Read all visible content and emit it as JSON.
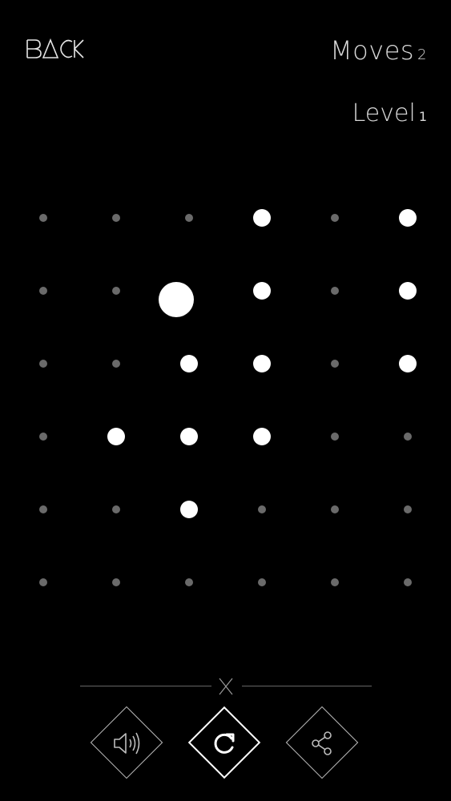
{
  "header": {
    "back_label": "BACK",
    "moves_label": "Moves",
    "moves_value": "2",
    "level_label": "Level",
    "level_value": "1"
  },
  "board": {
    "rows": 6,
    "cols": 6,
    "cells": [
      [
        "empty",
        "empty",
        "empty",
        "filled",
        "empty",
        "filled"
      ],
      [
        "empty",
        "empty",
        "big",
        "filled",
        "empty",
        "filled"
      ],
      [
        "empty",
        "empty",
        "filled",
        "filled",
        "empty",
        "filled"
      ],
      [
        "empty",
        "filled",
        "filled",
        "filled",
        "empty",
        "empty"
      ],
      [
        "empty",
        "empty",
        "filled",
        "empty",
        "empty",
        "empty"
      ],
      [
        "empty",
        "empty",
        "empty",
        "empty",
        "empty",
        "empty"
      ]
    ]
  },
  "controls": {
    "buttons": [
      "sound-icon",
      "restart-icon",
      "share-icon"
    ]
  },
  "colors": {
    "background": "#000000",
    "active_dot": "#ffffff",
    "inactive_dot": "#6a6a6a"
  }
}
